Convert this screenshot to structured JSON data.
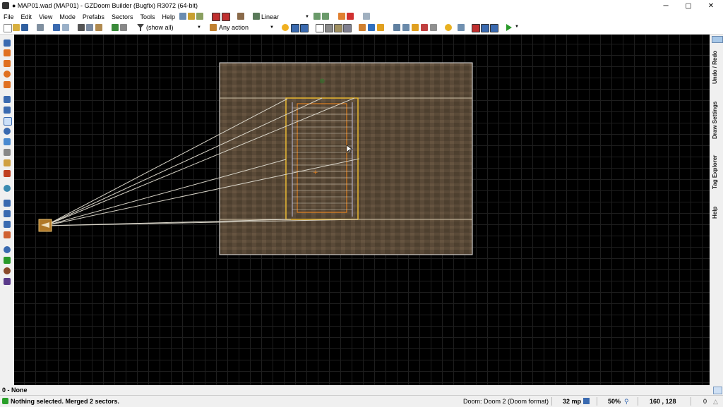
{
  "window": {
    "title": "● MAP01.wad (MAP01) - GZDoom Builder (Bugfix) R3072 (64-bit)",
    "minimize": "─",
    "maximize": "▢",
    "close": "✕"
  },
  "menu": [
    "File",
    "Edit",
    "View",
    "Mode",
    "Prefabs",
    "Sectors",
    "Tools",
    "Help"
  ],
  "toolbar": {
    "interpolation": "Linear",
    "filter": "(show all)",
    "action": "Any action"
  },
  "right_panel_tabs": [
    "Undo / Redo",
    "Draw Settings",
    "Tag Explorer",
    "Help"
  ],
  "info_line": "0 - None",
  "status": {
    "message": "Nothing selected. Merged 2 sectors.",
    "game": "Doom: Doom 2 (Doom format)",
    "grid": "32 mp",
    "zoom": "50%",
    "coords": "160 , 128",
    "counter": "0"
  }
}
